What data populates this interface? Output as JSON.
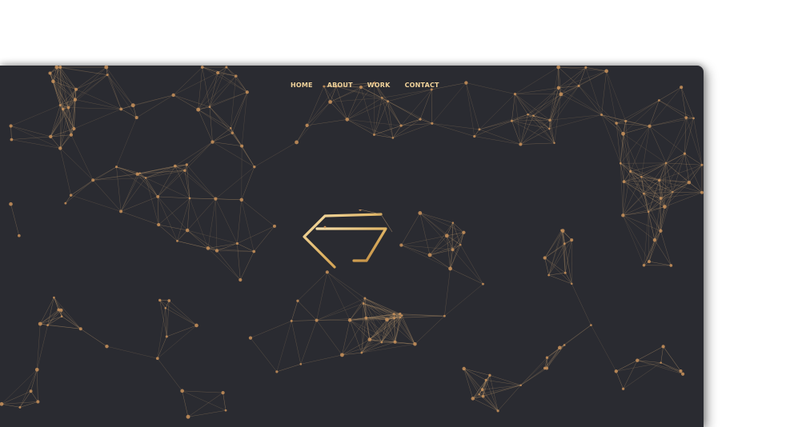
{
  "nav": {
    "items": [
      {
        "label": "HOME"
      },
      {
        "label": "ABOUT"
      },
      {
        "label": "WORK"
      },
      {
        "label": "CONTACT"
      }
    ]
  },
  "colors": {
    "background": "#2a2b31",
    "accent": "#e8c27a",
    "line": "#b8956a",
    "node": "#c9925a"
  },
  "icons": {
    "logo": "monogram-logo-icon"
  }
}
